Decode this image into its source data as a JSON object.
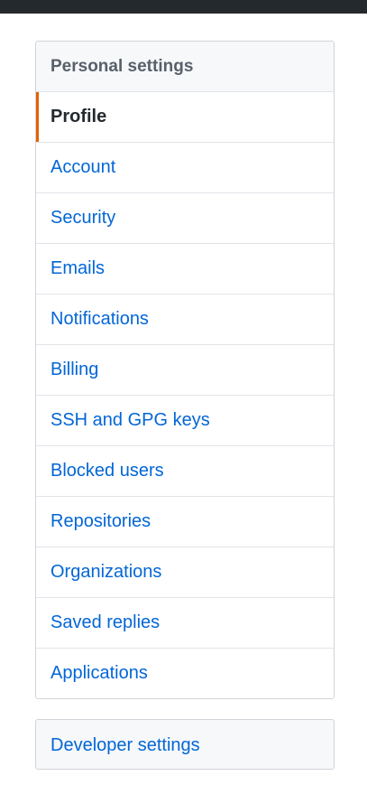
{
  "personal_settings": {
    "heading": "Personal settings",
    "items": [
      {
        "label": "Profile"
      },
      {
        "label": "Account"
      },
      {
        "label": "Security"
      },
      {
        "label": "Emails"
      },
      {
        "label": "Notifications"
      },
      {
        "label": "Billing"
      },
      {
        "label": "SSH and GPG keys"
      },
      {
        "label": "Blocked users"
      },
      {
        "label": "Repositories"
      },
      {
        "label": "Organizations"
      },
      {
        "label": "Saved replies"
      },
      {
        "label": "Applications"
      }
    ],
    "selected": "Profile"
  },
  "developer_settings": {
    "label": "Developer settings"
  },
  "colors": {
    "link": "#0366d6",
    "selected_text": "#24292e",
    "selected_accent": "#e36209",
    "heading_text": "#586069",
    "heading_bg": "#f6f8fa",
    "top_bar": "#24292e"
  }
}
